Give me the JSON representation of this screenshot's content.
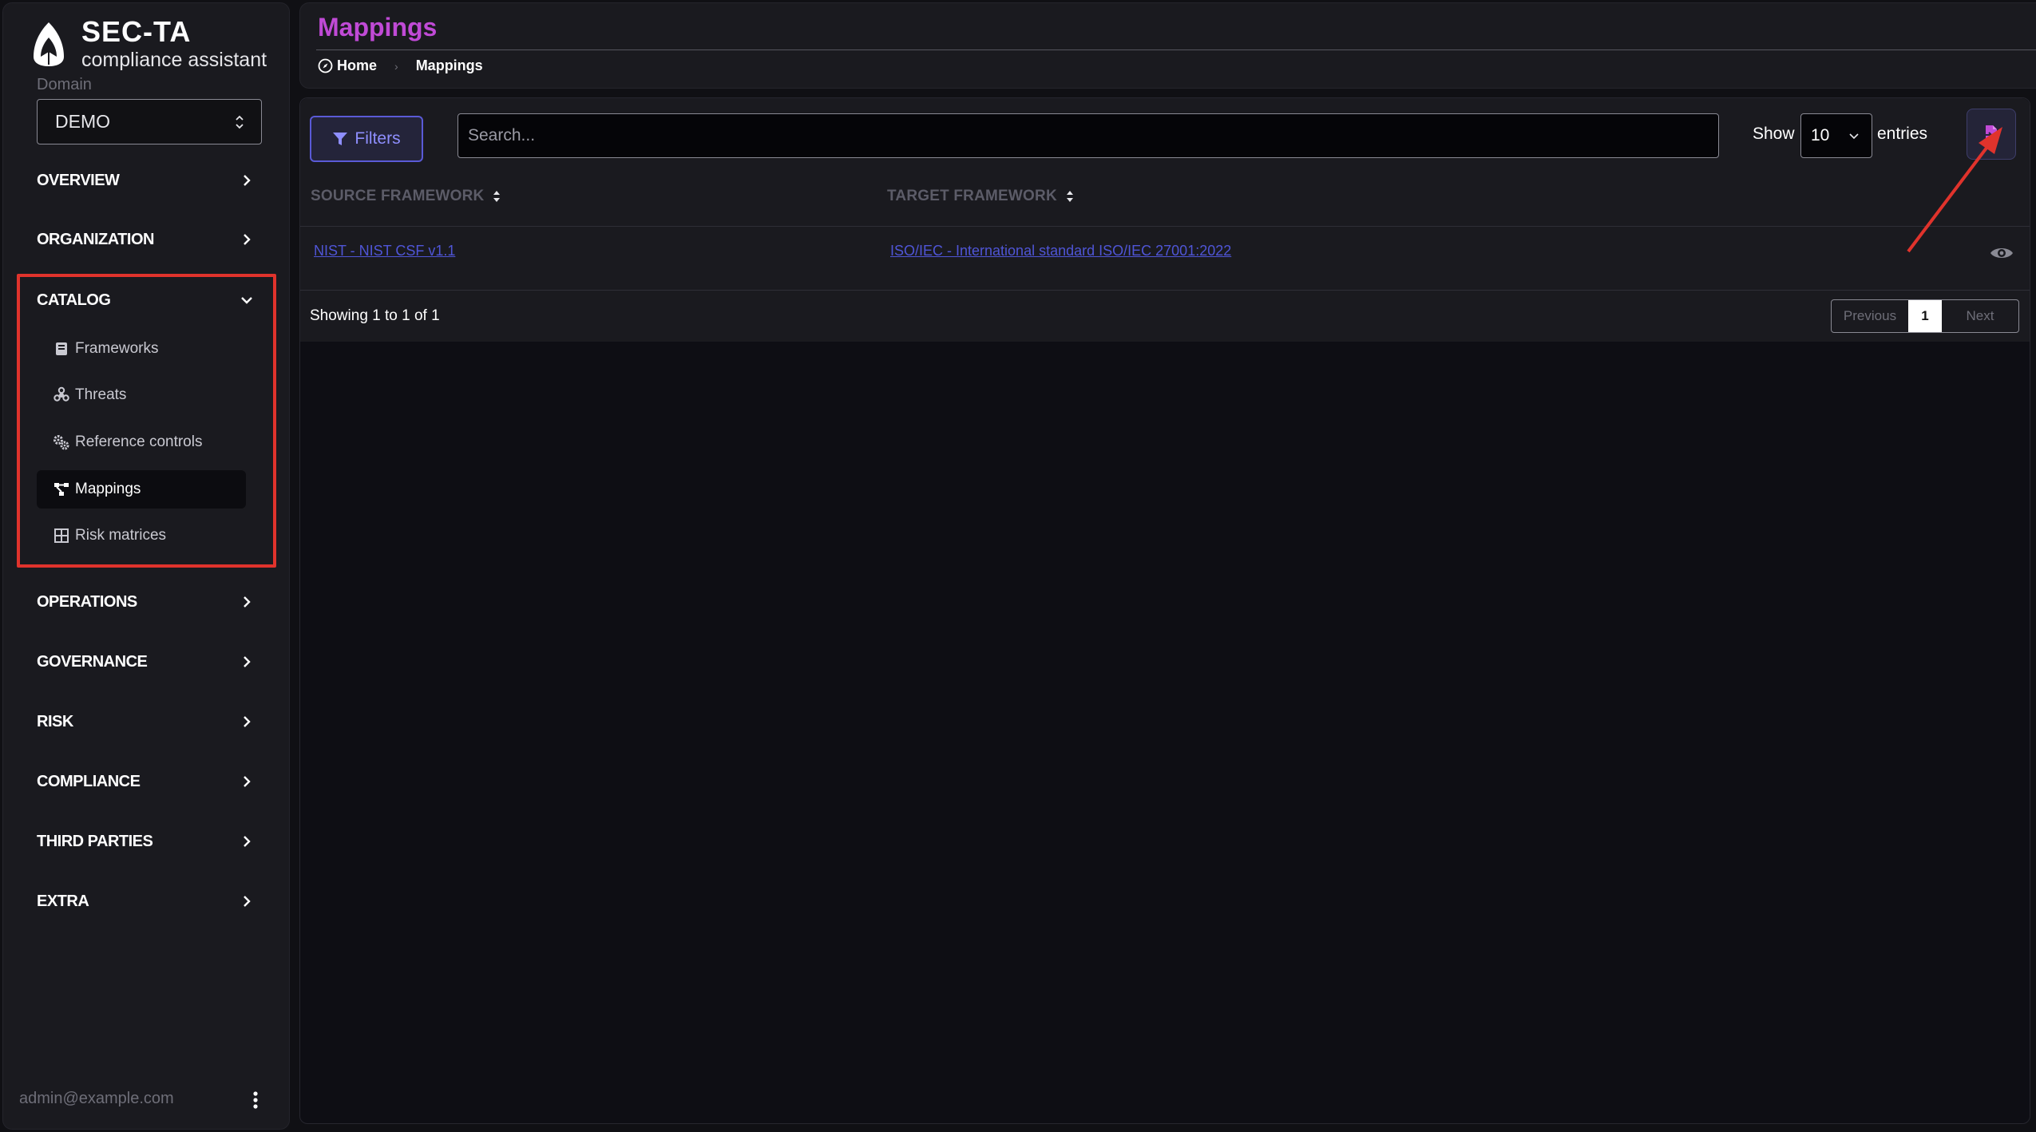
{
  "brand": {
    "name": "SEC-TA",
    "tagline": "compliance assistant"
  },
  "domain": {
    "label": "Domain",
    "value": "DEMO"
  },
  "nav": {
    "overview": "OVERVIEW",
    "organization": "ORGANIZATION",
    "catalog": "CATALOG",
    "operations": "OPERATIONS",
    "governance": "GOVERNANCE",
    "risk": "RISK",
    "compliance": "COMPLIANCE",
    "third_parties": "THIRD PARTIES",
    "extra": "EXTRA"
  },
  "catalog_items": [
    {
      "label": "Frameworks",
      "icon": "book-icon"
    },
    {
      "label": "Threats",
      "icon": "biohazard-icon"
    },
    {
      "label": "Reference controls",
      "icon": "gears-icon"
    },
    {
      "label": "Mappings",
      "icon": "diagram-icon",
      "active": true
    },
    {
      "label": "Risk matrices",
      "icon": "table-grid-icon"
    }
  ],
  "user": {
    "email": "admin@example.com"
  },
  "header": {
    "title": "Mappings",
    "breadcrumb": {
      "home": "Home",
      "current": "Mappings"
    }
  },
  "toolbar": {
    "filters_label": "Filters",
    "search_placeholder": "Search...",
    "show_label": "Show",
    "entries_value": "10",
    "entries_label": "entries"
  },
  "table": {
    "columns": [
      "SOURCE FRAMEWORK",
      "TARGET FRAMEWORK"
    ],
    "rows": [
      {
        "source": "NIST - NIST CSF v1.1",
        "target": "ISO/IEC - International standard ISO/IEC 27001:2022"
      }
    ]
  },
  "footer": {
    "showing": "Showing 1 to 1 of 1",
    "previous": "Previous",
    "page": "1",
    "next": "Next"
  },
  "colors": {
    "accent": "#c04ad6",
    "link": "#4f55d6",
    "highlight": "#e0332c",
    "filter_border": "#5a5ad6"
  }
}
